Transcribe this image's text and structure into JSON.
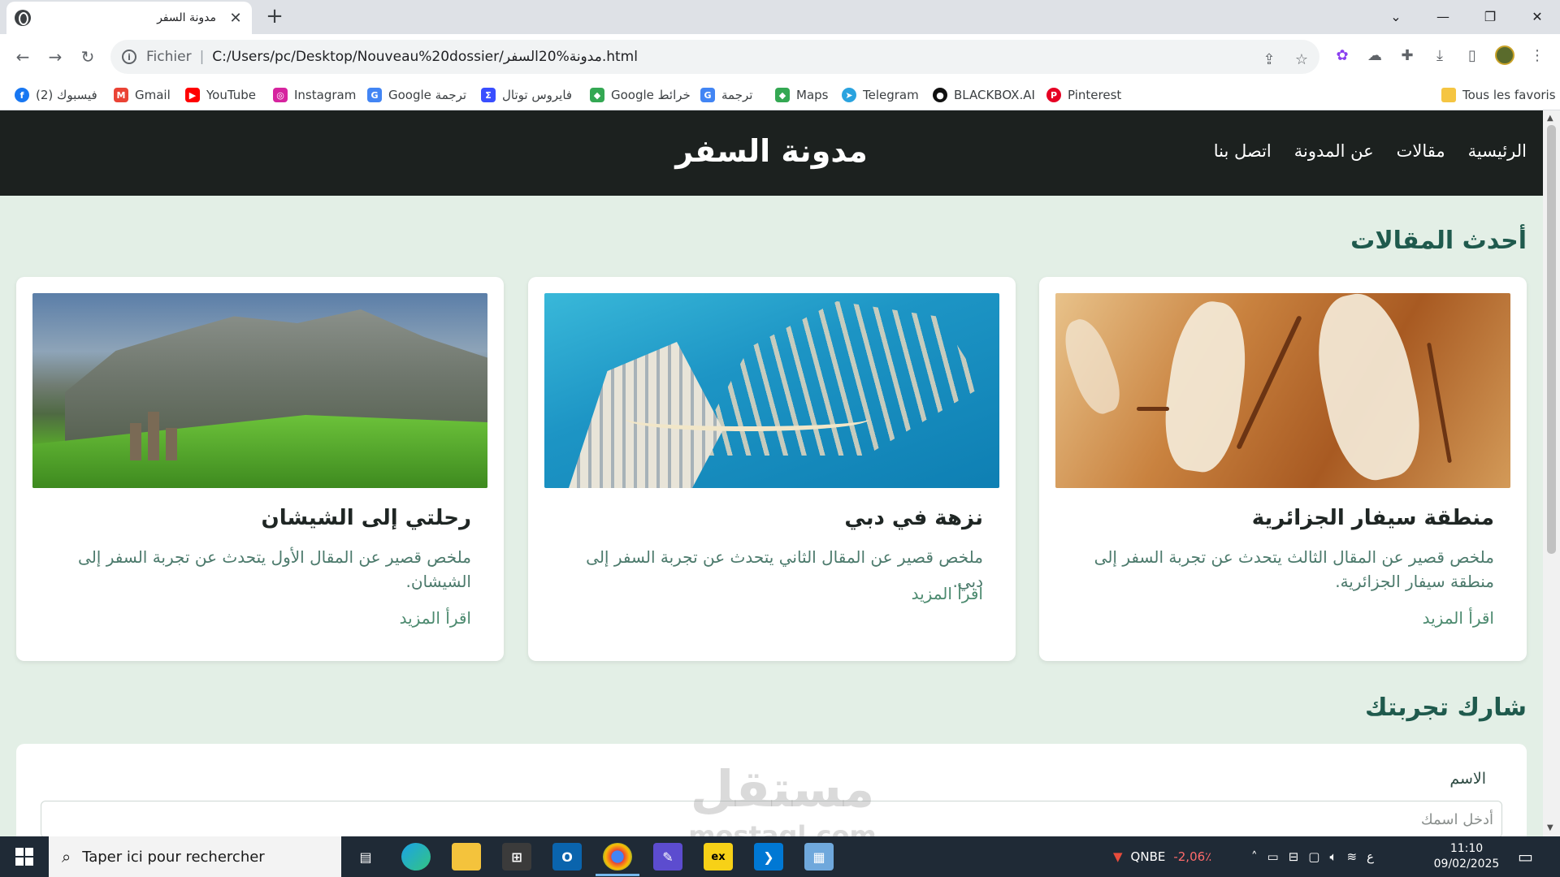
{
  "browser": {
    "tab_title": "مدونة السفر",
    "tab_close": "✕",
    "new_tab": "+",
    "window_controls": {
      "tabsearch": "⌄",
      "minimize": "—",
      "restore": "❐",
      "close": "✕"
    },
    "address": {
      "scheme": "Fichier",
      "url": "C:/Users/pc/Desktop/Nouveau%20dossier/مدونة%20السفر.html"
    },
    "bookmarks": [
      {
        "label": "(2) فيسبوك",
        "icon": "facebook-icon",
        "color": "#1877f2",
        "glyph": "f"
      },
      {
        "label": "Gmail",
        "icon": "gmail-icon",
        "color": "#ea4335",
        "glyph": "M"
      },
      {
        "label": "YouTube",
        "icon": "youtube-icon",
        "color": "#ff0000",
        "glyph": "▶"
      },
      {
        "label": "Instagram",
        "icon": "instagram-icon",
        "color": "#d6249f",
        "glyph": "◎"
      },
      {
        "label": "Google ترجمة",
        "icon": "google-translate-icon",
        "color": "#4285f4",
        "glyph": "G"
      },
      {
        "label": "فايروس توتال",
        "icon": "virustotal-icon",
        "color": "#394eff",
        "glyph": "Σ"
      },
      {
        "label": "Google خرائط",
        "icon": "google-maps-icon",
        "color": "#34a853",
        "glyph": "◆"
      },
      {
        "label": "ترجمة",
        "icon": "translate-icon",
        "color": "#4285f4",
        "glyph": "G"
      },
      {
        "label": "Maps",
        "icon": "maps-icon",
        "color": "#34a853",
        "glyph": "◆"
      },
      {
        "label": "Telegram",
        "icon": "telegram-icon",
        "color": "#2aa3df",
        "glyph": "➤"
      },
      {
        "label": "BLACKBOX.AI",
        "icon": "blackbox-icon",
        "color": "#111111",
        "glyph": "●"
      },
      {
        "label": "Pinterest",
        "icon": "pinterest-icon",
        "color": "#e60023",
        "glyph": "P"
      }
    ],
    "all_bookmarks": "Tous les favoris"
  },
  "site": {
    "title": "مدونة السفر",
    "nav": [
      "الرئيسية",
      "مقالات",
      "عن المدونة",
      "اتصل بنا"
    ],
    "latest_heading": "أحدث المقالات",
    "articles": [
      {
        "title": "منطقة سيفار الجزائرية",
        "summary": "ملخص قصير عن المقال الثالث يتحدث عن تجربة السفر إلى منطقة سيفار الجزائرية.",
        "more": "اقرأ المزيد"
      },
      {
        "title": "نزهة في دبي",
        "summary": "ملخص قصير عن المقال الثاني يتحدث عن تجربة السفر إلى دبي.",
        "more": "اقرأ المزيد"
      },
      {
        "title": "رحلتي إلى الشيشان",
        "summary": "ملخص قصير عن المقال الأول يتحدث عن تجربة السفر إلى الشيشان.",
        "more": "اقرأ المزيد"
      }
    ],
    "share_heading": "شارك تجربتك",
    "form": {
      "name_label": "الاسم",
      "name_placeholder": "أدخل اسمك"
    },
    "watermark": {
      "top": "مستقل",
      "bottom": "mostaql.com"
    }
  },
  "taskbar": {
    "search_placeholder": "Taper ici pour rechercher",
    "stock_name": "QNBE",
    "stock_change": "-2,06٪",
    "input_lang": "ع",
    "time": "11:10",
    "date": "09/02/2025",
    "colors": {
      "stock_down": "#ff6b6b"
    }
  }
}
